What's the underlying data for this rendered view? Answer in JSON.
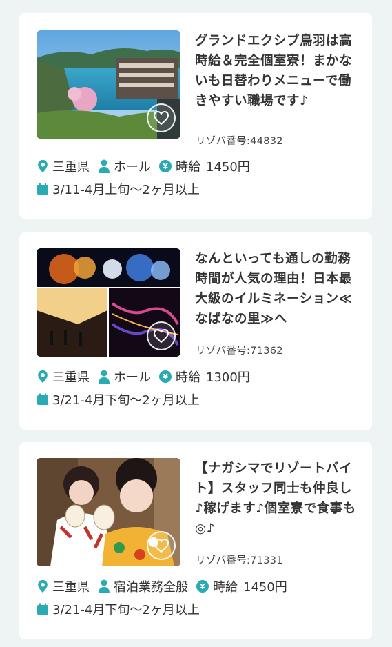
{
  "accent_color": "#2aabb3",
  "cards": [
    {
      "title": "グランドエクシブ鳥羽は高時給＆完全個室寮！まかないも日替わりメニューで働きやすい職場です♪",
      "rizoba": "リゾバ番号:44832",
      "location": "三重県",
      "job": "ホール",
      "pay_label": "時給",
      "pay": "1450円",
      "period": "3/11-4月上旬～2ヶ月以上",
      "image": "resort-hotel-lake-photo"
    },
    {
      "title": "なんといっても通しの勤務時間が人気の理由！日本最大級のイルミネーション≪なばなの里≫へ",
      "rizoba": "リゾバ番号:71362",
      "location": "三重県",
      "job": "ホール",
      "pay_label": "時給",
      "pay": "1300円",
      "period": "3/21-4月下旬～2ヶ月以上",
      "image": "illumination-collage-photo"
    },
    {
      "title": "【ナガシマでリゾートバイト】スタッフ同士も仲良し♪稼げます♪個室寮で食事も◎♪",
      "rizoba": "リゾバ番号:71331",
      "location": "三重県",
      "job": "宿泊業務全般",
      "pay_label": "時給",
      "pay": "1450円",
      "period": "3/21-4月下旬～2ヶ月以上",
      "image": "staff-yukata-photo"
    }
  ]
}
